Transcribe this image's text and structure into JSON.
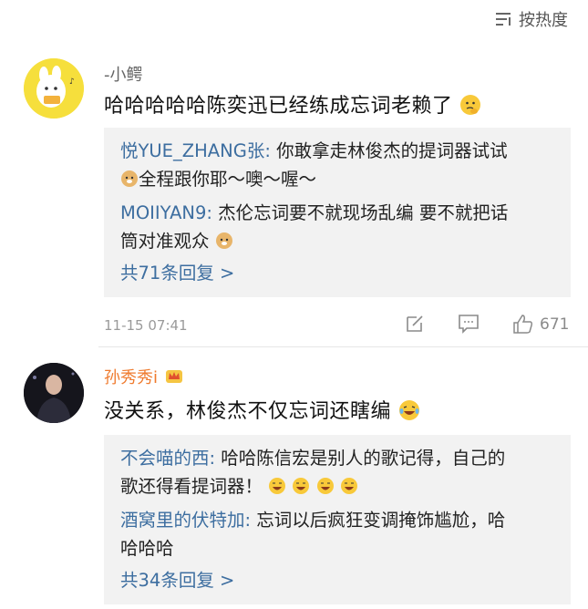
{
  "sort": {
    "label": "按热度",
    "icon": "sort-lines-icon"
  },
  "comments": [
    {
      "username": "-小鳄",
      "content": "哈哈哈哈哈陈奕迅已经练成忘词老赖了",
      "content_emoji": "thinking-emoji",
      "replies": [
        {
          "name": "悦YUE_ZHANG张:",
          "text_line1": " 你敢拿走林俊杰的提词器试试",
          "text_line2": "全程跟你耶～噢～喔～",
          "emoji": "doge-emoji"
        },
        {
          "name": "MOIIYAN9:",
          "text_line1": " 杰伦忘词要不就现场乱编 要不就把话",
          "text_line2": "筒对准观众",
          "emoji": "doge-emoji"
        }
      ],
      "more_replies": "共71条回复 >",
      "time": "11-15 07:41",
      "likes": "671"
    },
    {
      "username": "孙秀秀i",
      "badge": "crown-icon",
      "content": "没关系，林俊杰不仅忘词还瞎编",
      "content_emoji": "laugh-cry-emoji",
      "replies": [
        {
          "name": "不会喵的西:",
          "text_line1": " 哈哈陈信宏是别人的歌记得，自己的",
          "text_line2": "歌还得看提词器！",
          "emoji": "laugh-cry-emoji"
        },
        {
          "name": "酒窝里的伏特加:",
          "text_line1": " 忘词以后疯狂变调掩饰尴尬，哈",
          "text_line2": "哈哈哈"
        }
      ],
      "more_replies": "共34条回复 >"
    }
  ],
  "colors": {
    "link": "#3d6ea0",
    "orange_name": "#ef7a2d",
    "reply_bg": "#f2f2f2"
  }
}
